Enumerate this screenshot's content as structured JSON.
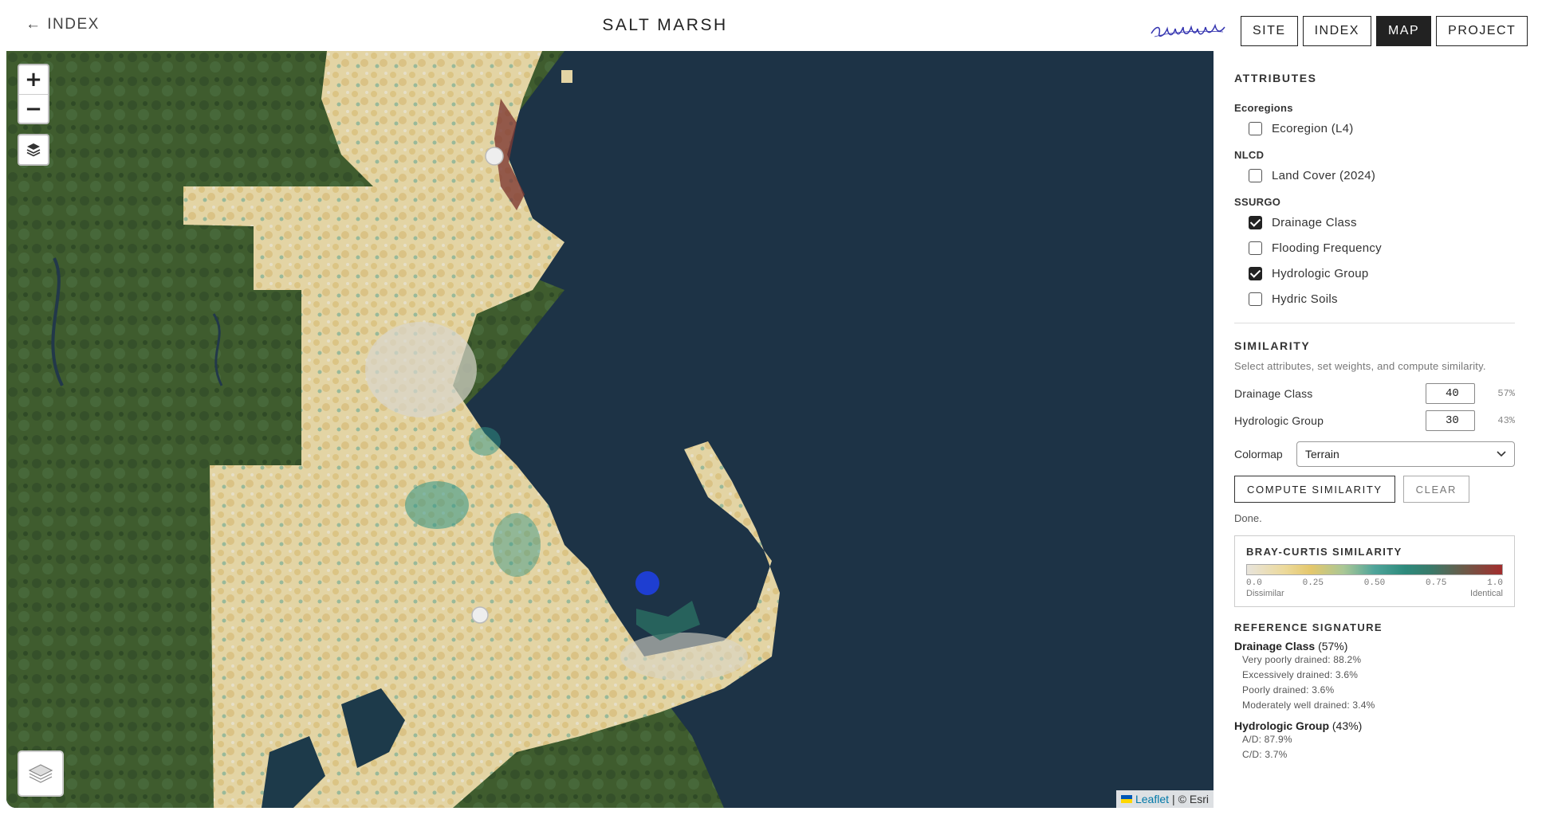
{
  "header": {
    "back_label": "← INDEX",
    "title": "SALT MARSH",
    "signature_text": "analog",
    "nav": [
      {
        "label": "SITE",
        "active": false
      },
      {
        "label": "INDEX",
        "active": false
      },
      {
        "label": "MAP",
        "active": true
      },
      {
        "label": "PROJECT",
        "active": false
      }
    ]
  },
  "map": {
    "zoom_in": "+",
    "zoom_out": "−",
    "attribution_leaflet": "Leaflet",
    "attribution_sep": "|",
    "attribution_esri": "© Esri",
    "icons": {
      "layers": "layers-icon",
      "flag": "ukraine-flag-icon"
    }
  },
  "panel": {
    "attributes_title": "ATTRIBUTES",
    "groups": [
      {
        "label": "Ecoregions",
        "items": [
          {
            "label": "Ecoregion (L4)",
            "checked": false
          }
        ]
      },
      {
        "label": "NLCD",
        "items": [
          {
            "label": "Land Cover (2024)",
            "checked": false
          }
        ]
      },
      {
        "label": "SSURGO",
        "items": [
          {
            "label": "Drainage Class",
            "checked": true
          },
          {
            "label": "Flooding Frequency",
            "checked": false
          },
          {
            "label": "Hydrologic Group",
            "checked": true
          },
          {
            "label": "Hydric Soils",
            "checked": false
          }
        ]
      }
    ],
    "similarity": {
      "title": "SIMILARITY",
      "help": "Select attributes, set weights, and compute similarity.",
      "weights": [
        {
          "label": "Drainage Class",
          "value": "40",
          "pct": "57%"
        },
        {
          "label": "Hydrologic Group",
          "value": "30",
          "pct": "43%"
        }
      ],
      "colormap_label": "Colormap",
      "colormap_value": "Terrain",
      "compute_label": "COMPUTE SIMILARITY",
      "clear_label": "CLEAR",
      "status": "Done."
    },
    "legend": {
      "title": "BRAY-CURTIS SIMILARITY",
      "ticks": [
        "0.0",
        "0.25",
        "0.50",
        "0.75",
        "1.0"
      ],
      "low_label": "Dissimilar",
      "high_label": "Identical"
    },
    "reference": {
      "title": "REFERENCE SIGNATURE",
      "groups": [
        {
          "name": "Drainage Class",
          "pct": "(57%)",
          "items": [
            "Very poorly drained: 88.2%",
            "Excessively drained: 3.6%",
            "Poorly drained: 3.6%",
            "Moderately well drained: 3.4%"
          ]
        },
        {
          "name": "Hydrologic Group",
          "pct": "(43%)",
          "items": [
            "A/D: 87.9%",
            "C/D: 3.7%"
          ]
        }
      ]
    }
  },
  "colors": {
    "ocean": "#1d3346",
    "forest": "#3d5a2c",
    "land_overlay": "#e6d6a6",
    "teal": "#2e8c80",
    "marsh_red": "#8a3a34",
    "selected_point": "#1f3fe0"
  }
}
